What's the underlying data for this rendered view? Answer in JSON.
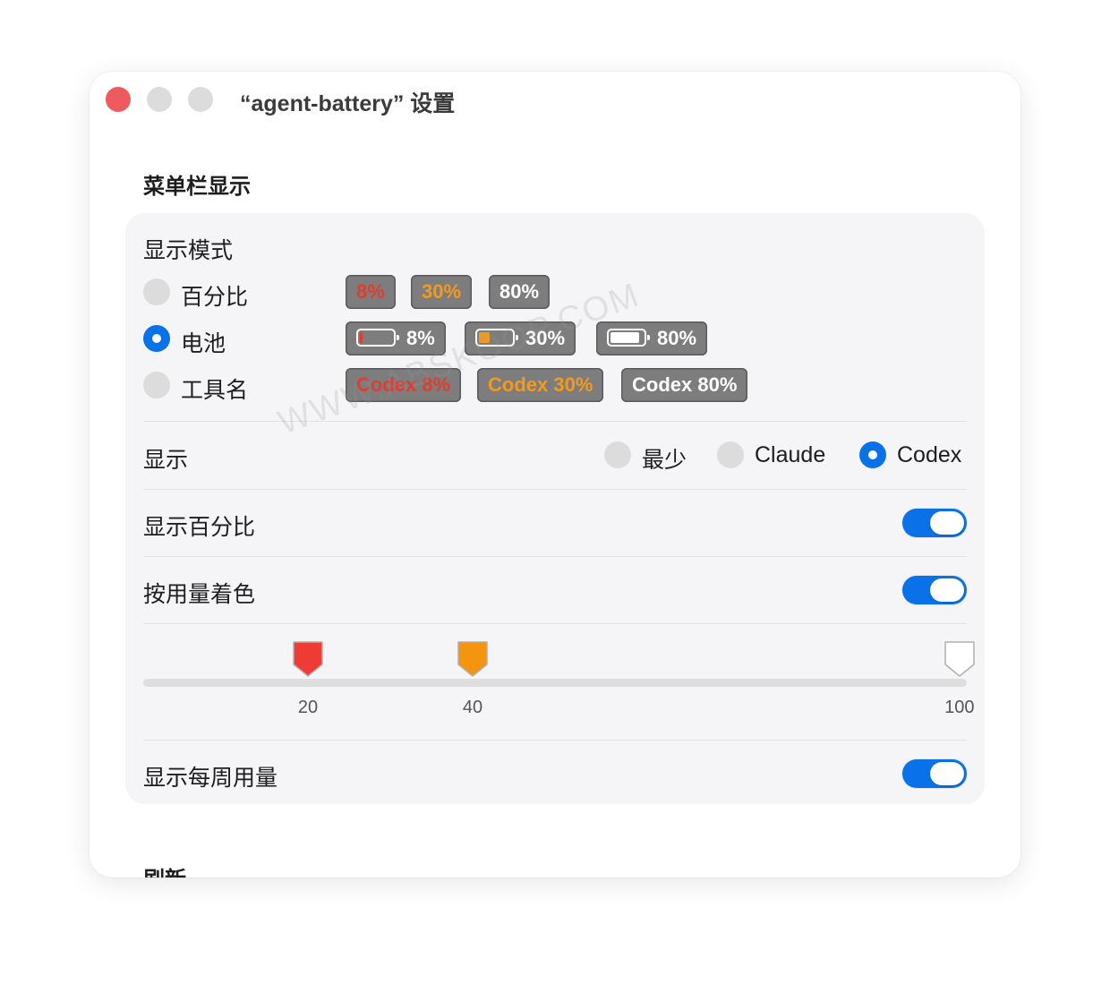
{
  "window": {
    "title": "“agent-battery” 设置"
  },
  "sections": {
    "menubar": "菜单栏显示",
    "refresh": "刷新"
  },
  "display_mode": {
    "label": "显示模式",
    "options": [
      {
        "label": "百分比",
        "selected": false,
        "chips": [
          {
            "text": "8%",
            "color": "red"
          },
          {
            "text": "30%",
            "color": "orange"
          },
          {
            "text": "80%",
            "color": "white"
          }
        ]
      },
      {
        "label": "电池",
        "selected": true,
        "chips": [
          {
            "text": "8%",
            "battery_level": 0.08
          },
          {
            "text": "30%",
            "battery_level": 0.3
          },
          {
            "text": "80%",
            "battery_level": 0.8
          }
        ]
      },
      {
        "label": "工具名",
        "selected": false,
        "chips": [
          {
            "text": "Codex 8%",
            "color": "red"
          },
          {
            "text": "Codex 30%",
            "color": "orange"
          },
          {
            "text": "Codex 80%",
            "color": "white"
          }
        ]
      }
    ]
  },
  "display": {
    "label": "显示",
    "options": [
      {
        "label": "最少",
        "selected": false
      },
      {
        "label": "Claude",
        "selected": false
      },
      {
        "label": "Codex",
        "selected": true
      }
    ]
  },
  "show_percent": {
    "label": "显示百分比",
    "on": true
  },
  "color_by_usage": {
    "label": "按用量着色",
    "on": true
  },
  "thresholds": {
    "min": 0,
    "max": 100,
    "handles": [
      {
        "value": 20,
        "label": "20",
        "color": "#ee3b33"
      },
      {
        "value": 40,
        "label": "40",
        "color": "#f5950f"
      },
      {
        "value": 100,
        "label": "100",
        "color": "#ffffff"
      }
    ]
  },
  "show_weekly": {
    "label": "显示每周用量",
    "on": true
  },
  "watermark": "WWW.ABSKOOP.COM",
  "colors": {
    "accent": "#0a72e8",
    "red": "#e23b2f",
    "orange": "#f39a1e",
    "close": "#ee5a5e"
  }
}
